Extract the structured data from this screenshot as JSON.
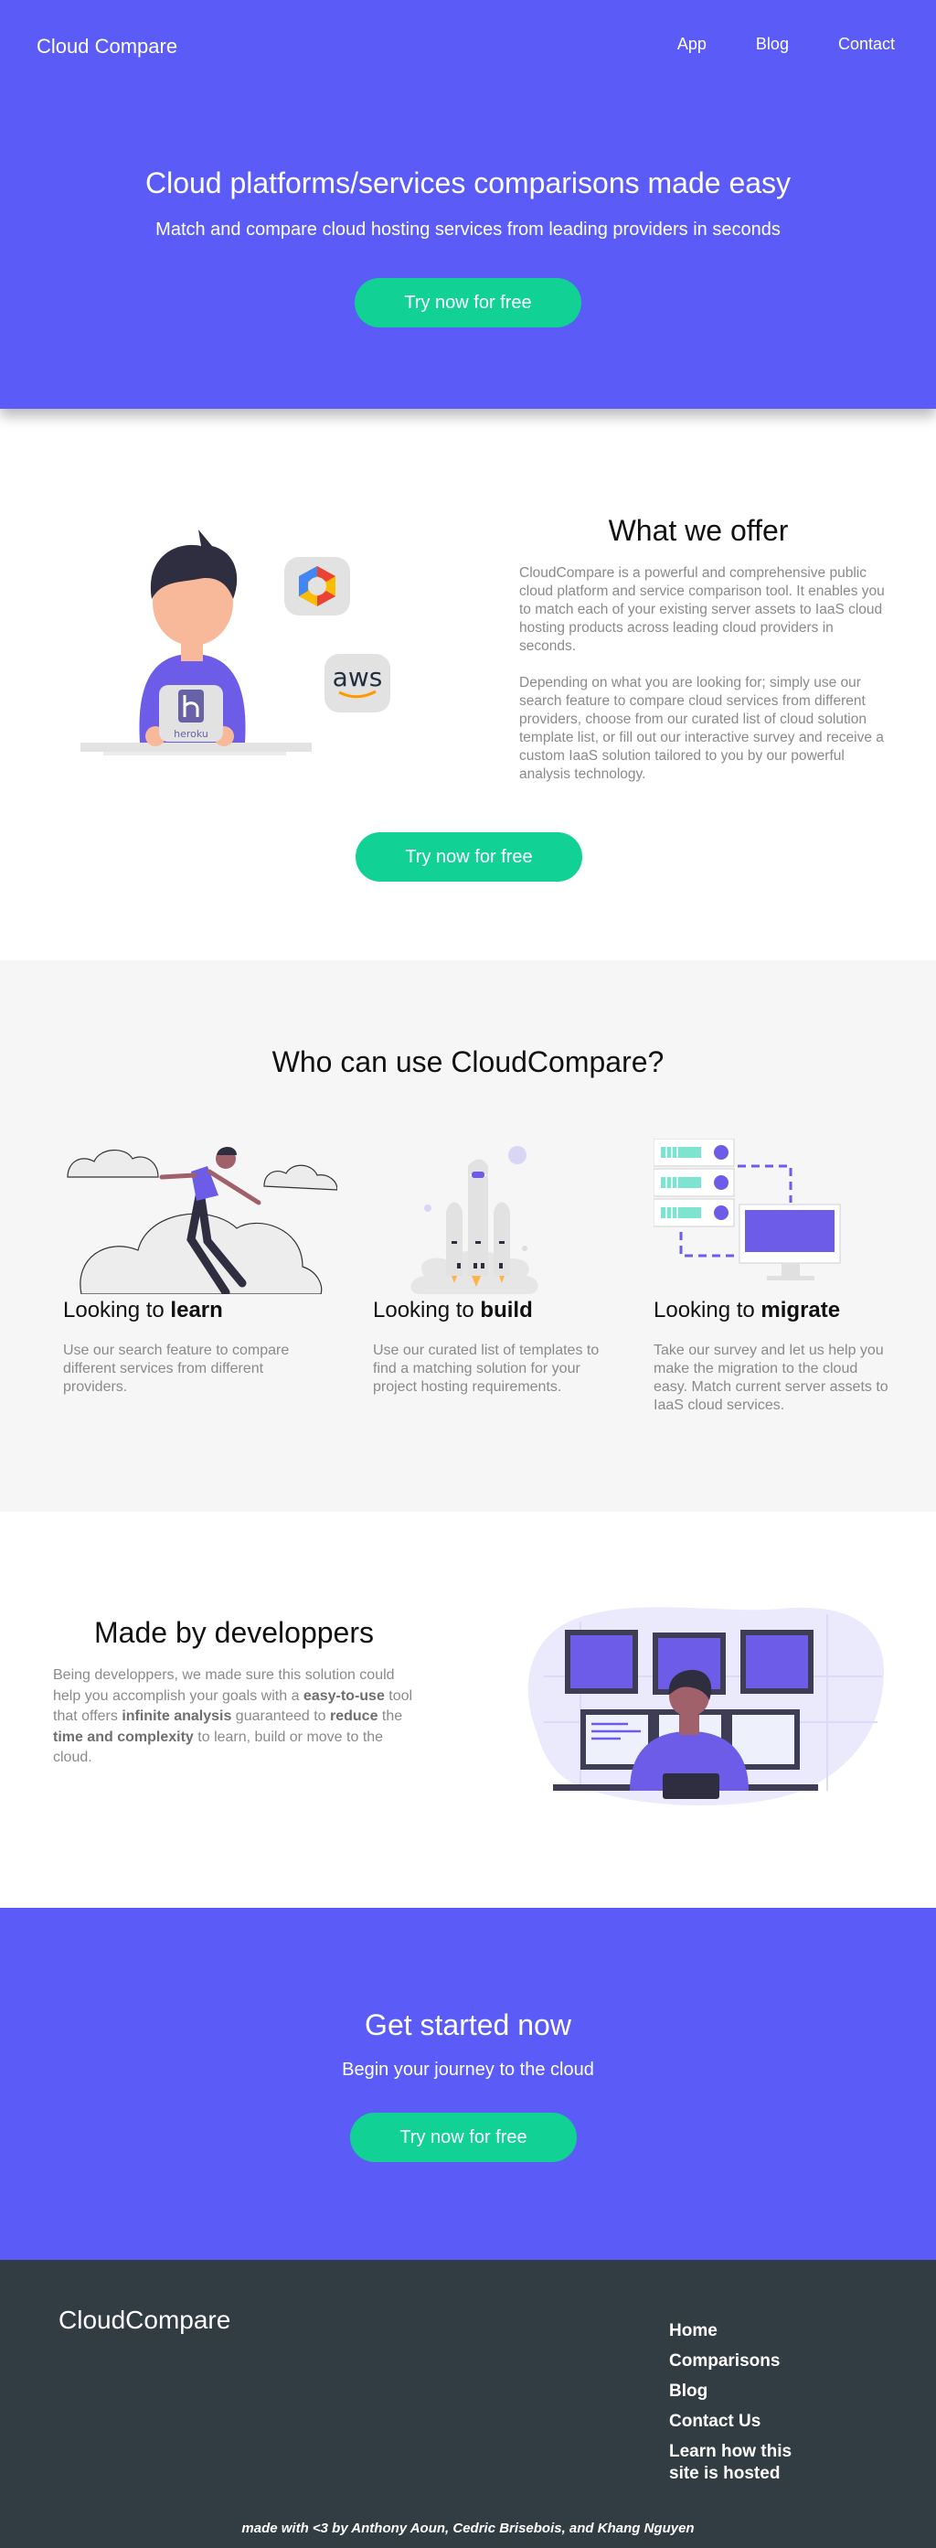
{
  "header": {
    "brand": "Cloud Compare",
    "nav": [
      "App",
      "Blog",
      "Contact"
    ]
  },
  "hero": {
    "title": "Cloud platforms/services comparisons made easy",
    "subtitle": "Match and compare cloud hosting services from leading providers in seconds",
    "cta": "Try now for free"
  },
  "offer": {
    "title": "What we offer",
    "p1": "CloudCompare is a powerful and comprehensive public cloud platform and service comparison tool. It enables you to match each of your existing server assets to IaaS cloud hosting products across leading cloud providers in seconds.",
    "p2": "Depending on what you are looking for; simply use our search feature to compare cloud services from different providers, choose from our curated list of cloud solution template list, or fill out our interactive survey and receive a custom IaaS solution tailored to you by our powerful analysis technology.",
    "cta": "Try now for free",
    "illustration": {
      "heroku_label": "heroku",
      "aws_label": "aws"
    }
  },
  "who": {
    "title": "Who can use CloudCompare?",
    "columns": [
      {
        "prefix": "Looking to ",
        "bold": "learn",
        "text": "Use our search feature to compare different services from different providers."
      },
      {
        "prefix": "Looking to ",
        "bold": "build",
        "text": "Use our curated list of templates to find a matching solution for your project hosting requirements."
      },
      {
        "prefix": "Looking to ",
        "bold": "migrate",
        "text": "Take our survey and let us help you make the migration to the cloud easy. Match current server assets to IaaS cloud services."
      }
    ]
  },
  "made": {
    "title": "Made by developpers",
    "p": [
      "Being developpers, we made sure this solution could help you accomplish your goals with a ",
      "easy-to-use",
      " tool that offers ",
      "infinite analysis",
      " guaranteed to ",
      "reduce",
      " the ",
      "time and complexity",
      "  to learn, build or move to the cloud."
    ]
  },
  "started": {
    "title": "Get started now",
    "subtitle": "Begin your journey to the cloud",
    "cta": "Try now for free"
  },
  "footer": {
    "brand": "CloudCompare",
    "links": [
      "Home",
      "Comparisons",
      "Blog",
      "Contact Us",
      "Learn how this site is hosted"
    ],
    "credit": "made with <3 by Anthony Aoun, Cedric Brisebois, and Khang Nguyen"
  },
  "colors": {
    "primary": "#5b5bf8",
    "accent": "#12d195",
    "footer": "#323c43",
    "muted_text": "#8a8a8a"
  }
}
